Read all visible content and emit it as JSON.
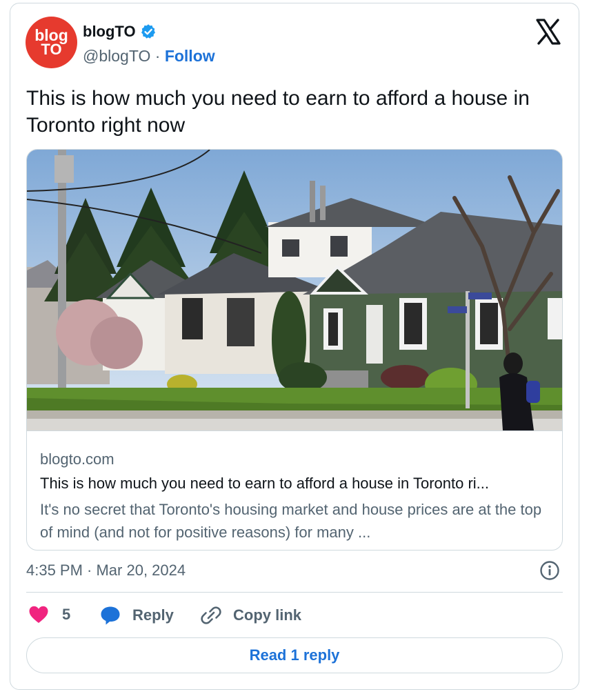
{
  "author": {
    "avatar_line1": "blog",
    "avatar_line2": "TO",
    "display_name": "blogTO",
    "handle": "@blogTO",
    "separator": "·",
    "follow_label": "Follow",
    "verified_icon": "verified-badge-icon"
  },
  "tweet": {
    "text": "This is how much you need to earn to afford a house in Toronto right now"
  },
  "link_card": {
    "image_icon": "house-photo",
    "domain": "blogto.com",
    "title": "This is how much you need to earn to afford a house in Toronto ri...",
    "description": "It's no secret that Toronto's housing market and house prices are at the top of mind (and not for positive reasons) for many ..."
  },
  "meta": {
    "timestamp": "4:35 PM · Mar 20, 2024",
    "info_icon": "info-icon"
  },
  "actions": {
    "like_count": "5",
    "reply_label": "Reply",
    "copy_link_label": "Copy link"
  },
  "read_replies_label": "Read 1 reply",
  "colors": {
    "accent": "#1d72d8",
    "avatar": "#e63a2e",
    "like": "#f0247f",
    "verified": "#1d9bf0",
    "muted_text": "#536471",
    "border": "#cfd9de"
  }
}
